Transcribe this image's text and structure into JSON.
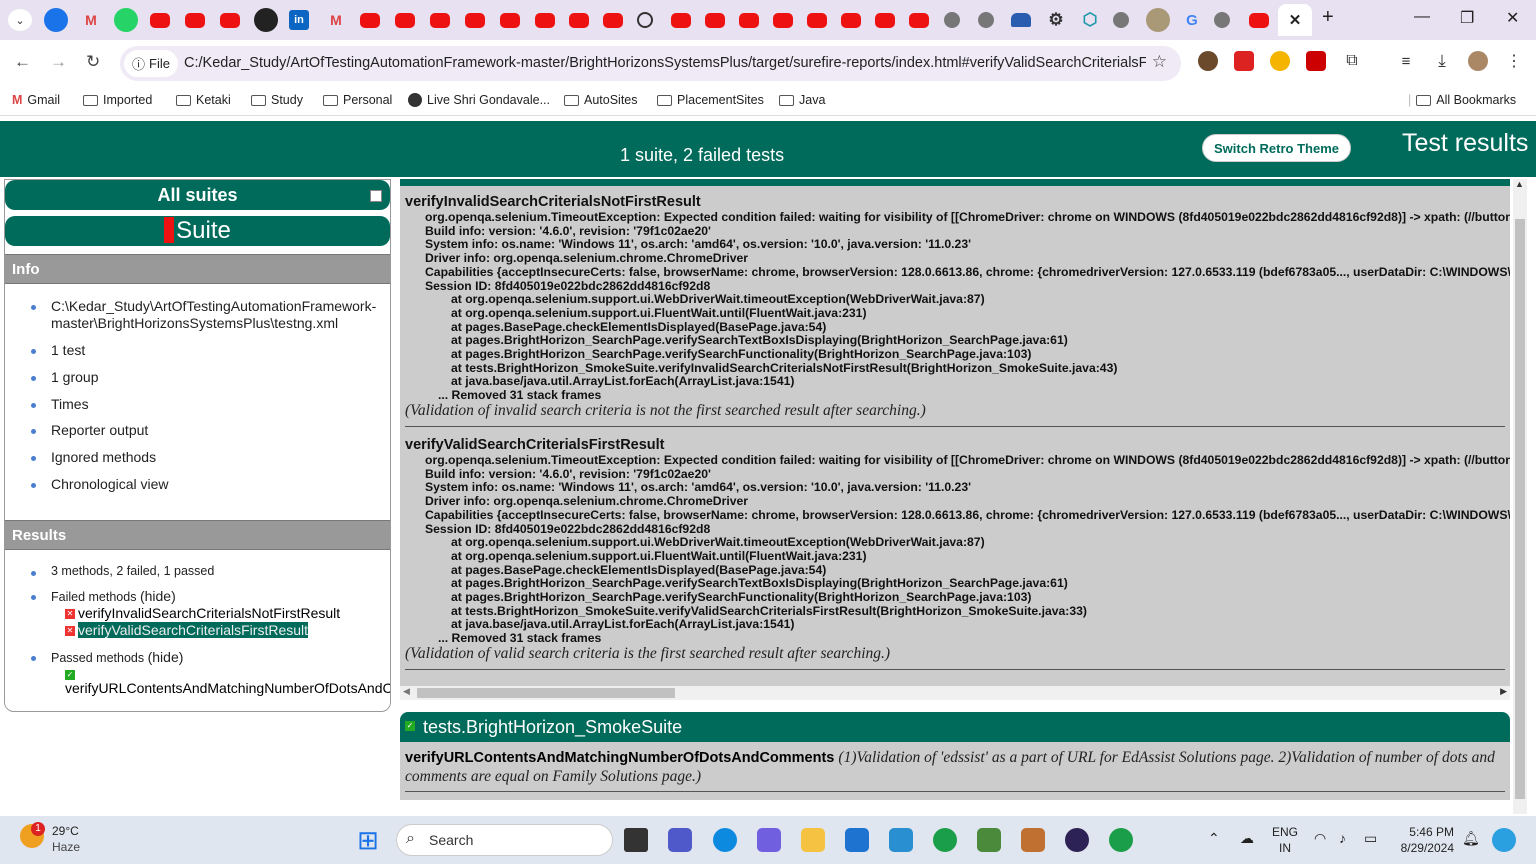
{
  "browser": {
    "url": "C:/Kedar_Study/ArtOfTestingAutomationFramework-master/BrightHorizonsSystemsPlus/target/surefire-reports/index.html#verifyValidSearchCriterialsFirs...",
    "file_chip": "File",
    "bookmarks": [
      "Gmail",
      "Imported",
      "Ketaki",
      "Study",
      "Personal",
      "Live Shri Gondavale...",
      "AutoSites",
      "PlacementSites",
      "Java"
    ],
    "all_bookmarks": "All Bookmarks"
  },
  "header": {
    "summary": "1 suite, 2 failed tests",
    "theme_button": "Switch Retro Theme",
    "title": "Test results"
  },
  "sidebar": {
    "all_suites": "All suites",
    "suite": "Suite",
    "info_label": "Info",
    "info_items": [
      "C:\\Kedar_Study\\ArtOfTestingAutomationFramework-",
      "master\\BrightHorizonsSystemsPlus\\testng.xml",
      "1 test",
      "1 group",
      "Times",
      "Reporter output",
      "Ignored methods",
      "Chronological view"
    ],
    "results_label": "Results",
    "results_summary": "3 methods, 2 failed, 1 passed",
    "failed_label": "Failed methods",
    "hide": "(hide)",
    "failed_methods": [
      "verifyInvalidSearchCriterialsNotFirstResult",
      "verifyValidSearchCriterialsFirstResult"
    ],
    "passed_label": "Passed methods",
    "passed_methods": [
      "verifyURLContentsAndMatchingNumberOfDotsAndC"
    ]
  },
  "failed": [
    {
      "name": "verifyInvalidSearchCriterialsNotFirstResult",
      "lines": [
        "org.openqa.selenium.TimeoutException: Expected condition failed: waiting for visibility of [[ChromeDriver: chrome on WINDOWS (8fd405019e022bdc2862dd4816cf92d8)] -> xpath: (//button[@",
        "Build info: version: '4.6.0', revision: '79f1c02ae20'",
        "System info: os.name: 'Windows 11', os.arch: 'amd64', os.version: '10.0', java.version: '11.0.23'",
        "Driver info: org.openqa.selenium.chrome.ChromeDriver",
        "Capabilities {acceptInsecureCerts: false, browserName: chrome, browserVersion: 128.0.6613.86, chrome: {chromedriverVersion: 127.0.6533.119 (bdef6783a05..., userDataDir: C:\\WINDOWS\\Sy:",
        "Session ID: 8fd405019e022bdc2862dd4816cf92d8"
      ],
      "frames": [
        "at org.openqa.selenium.support.ui.WebDriverWait.timeoutException(WebDriverWait.java:87)",
        "at org.openqa.selenium.support.ui.FluentWait.until(FluentWait.java:231)",
        "at pages.BasePage.checkElementIsDisplayed(BasePage.java:54)",
        "at pages.BrightHorizon_SearchPage.verifySearchTextBoxIsDisplaying(BrightHorizon_SearchPage.java:61)",
        "at pages.BrightHorizon_SearchPage.verifySearchFunctionality(BrightHorizon_SearchPage.java:103)",
        "at tests.BrightHorizon_SmokeSuite.verifyInvalidSearchCriterialsNotFirstResult(BrightHorizon_SmokeSuite.java:43)",
        "at java.base/java.util.ArrayList.forEach(ArrayList.java:1541)"
      ],
      "removed": "... Removed 31 stack frames",
      "description": "(Validation of invalid search criteria is not the first searched result after searching.)"
    },
    {
      "name": "verifyValidSearchCriterialsFirstResult",
      "lines": [
        "org.openqa.selenium.TimeoutException: Expected condition failed: waiting for visibility of [[ChromeDriver: chrome on WINDOWS (8fd405019e022bdc2862dd4816cf92d8)] -> xpath: (//button[@",
        "Build info: version: '4.6.0', revision: '79f1c02ae20'",
        "System info: os.name: 'Windows 11', os.arch: 'amd64', os.version: '10.0', java.version: '11.0.23'",
        "Driver info: org.openqa.selenium.chrome.ChromeDriver",
        "Capabilities {acceptInsecureCerts: false, browserName: chrome, browserVersion: 128.0.6613.86, chrome: {chromedriverVersion: 127.0.6533.119 (bdef6783a05..., userDataDir: C:\\WINDOWS\\Sy:",
        "Session ID: 8fd405019e022bdc2862dd4816cf92d8"
      ],
      "frames": [
        "at org.openqa.selenium.support.ui.WebDriverWait.timeoutException(WebDriverWait.java:87)",
        "at org.openqa.selenium.support.ui.FluentWait.until(FluentWait.java:231)",
        "at pages.BasePage.checkElementIsDisplayed(BasePage.java:54)",
        "at pages.BrightHorizon_SearchPage.verifySearchTextBoxIsDisplaying(BrightHorizon_SearchPage.java:61)",
        "at pages.BrightHorizon_SearchPage.verifySearchFunctionality(BrightHorizon_SearchPage.java:103)",
        "at tests.BrightHorizon_SmokeSuite.verifyValidSearchCriterialsFirstResult(BrightHorizon_SmokeSuite.java:33)",
        "at java.base/java.util.ArrayList.forEach(ArrayList.java:1541)"
      ],
      "removed": "... Removed 31 stack frames",
      "description": "(Validation of valid search criteria is the first searched result after searching.)"
    }
  ],
  "passed": {
    "class_name": "tests.BrightHorizon_SmokeSuite",
    "method": "verifyURLContentsAndMatchingNumberOfDotsAndComments",
    "description_1": "(1)Validation of 'edssist' as a part of URL for EdAssist Solutions page. 2)Validation of number of dots and",
    "description_2": "comments are equal on Family Solutions page.)"
  },
  "taskbar": {
    "weather_temp": "29°C",
    "weather_desc": "Haze",
    "weather_badge": "1",
    "search": "Search",
    "lang": "ENG",
    "region": "IN",
    "time": "5:46 PM",
    "date": "8/29/2024"
  },
  "colors": {
    "accent": "#006b5b",
    "panel": "#cccccc",
    "fail": "#ee3333",
    "pass": "#22aa22"
  }
}
